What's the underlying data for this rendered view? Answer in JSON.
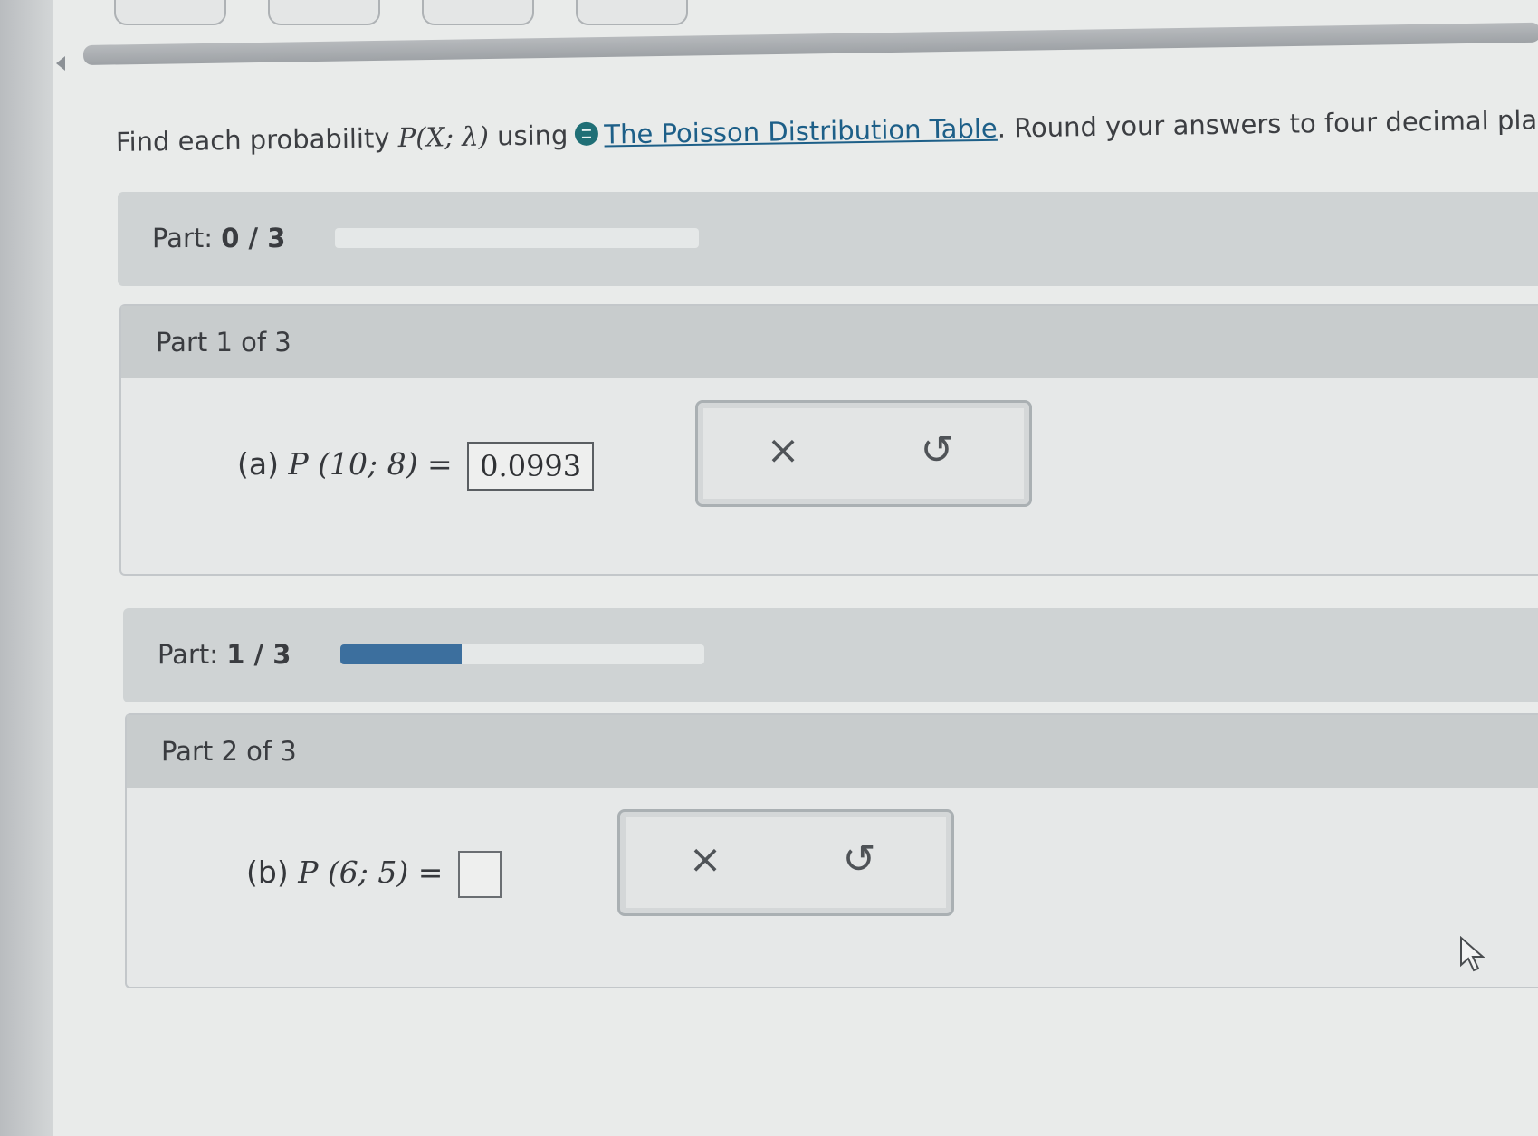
{
  "question": {
    "prefix": "Find each probability",
    "math": "P(X; λ)",
    "middle": "using",
    "link_text": "The Poisson Distribution Table",
    "suffix": ". Round your answers to four decimal plac"
  },
  "progress": [
    {
      "label": "Part:",
      "value": "0 / 3",
      "fraction": 0.0
    },
    {
      "label": "Part:",
      "value": "1 / 3",
      "fraction": 0.333
    }
  ],
  "parts": [
    {
      "header": "Part 1 of 3",
      "label": "(a)",
      "expression": "P (10; 8) =",
      "answer": "0.0993",
      "clear_symbol": "×",
      "undo_symbol": "↺"
    },
    {
      "header": "Part 2 of 3",
      "label": "(b)",
      "expression": "P (6; 5) =",
      "answer": "",
      "clear_symbol": "×",
      "undo_symbol": "↺"
    }
  ],
  "icons": {
    "info": "info-dot-icon",
    "clear": "close-icon",
    "undo": "undo-icon",
    "back": "left-arrow-icon"
  },
  "colors": {
    "accent": "#1f6f76",
    "link": "#1d5f88",
    "progress_fill": "#3c6f9e"
  }
}
